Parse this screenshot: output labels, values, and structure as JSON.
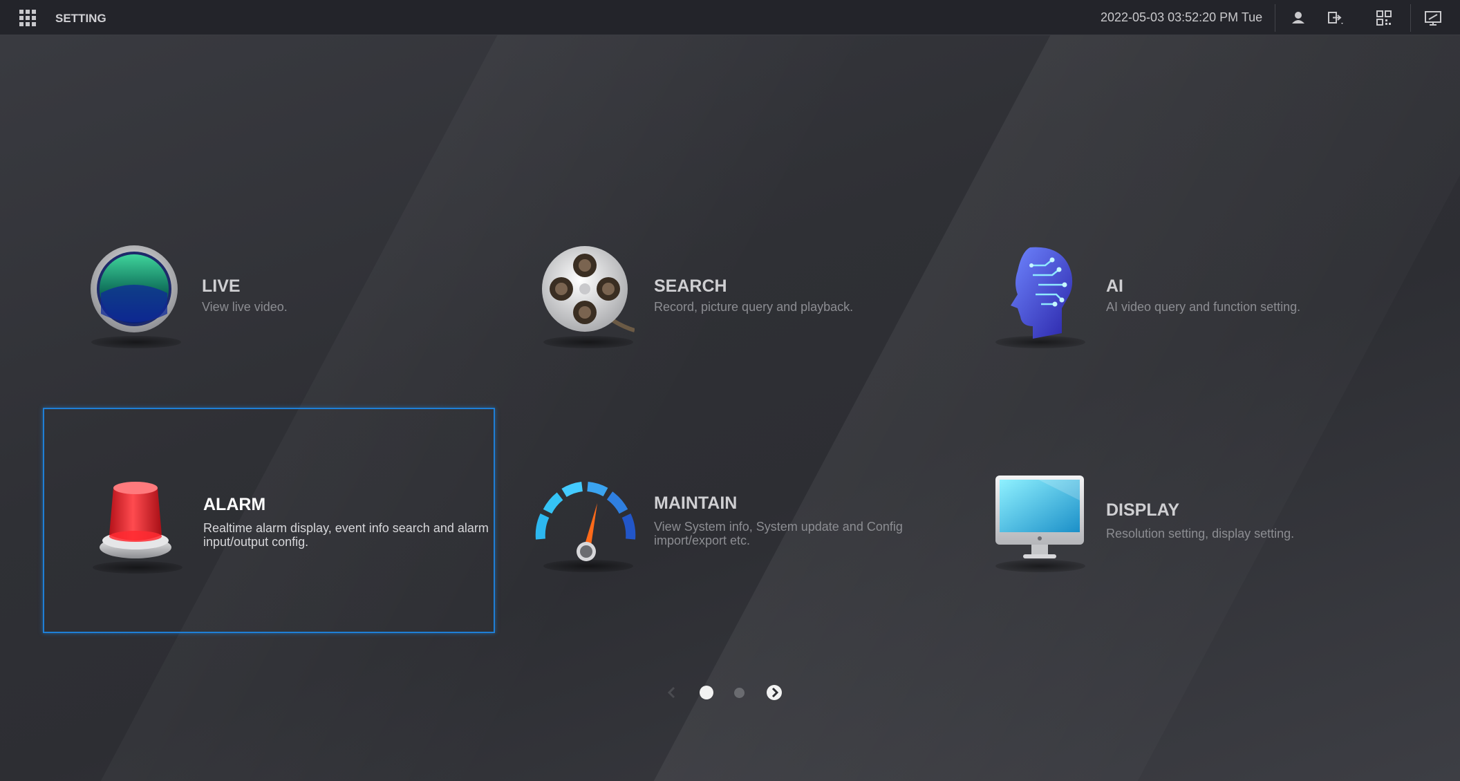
{
  "topbar": {
    "title": "SETTING",
    "datetime": "2022-05-03 03:52:20 PM Tue",
    "icons": [
      "grid-icon",
      "user-icon",
      "logout-icon",
      "qr-code-icon",
      "display-icon"
    ]
  },
  "tiles": [
    {
      "title": "LIVE",
      "desc": "View live video.",
      "icon": "live-icon"
    },
    {
      "title": "SEARCH",
      "desc": "Record, picture query and playback.",
      "icon": "film-reel-icon"
    },
    {
      "title": "AI",
      "desc": "AI video query and function setting.",
      "icon": "ai-head-icon"
    },
    {
      "title": "ALARM",
      "desc": "Realtime alarm display, event info search and alarm input/output config.",
      "icon": "alarm-siren-icon",
      "selected": true
    },
    {
      "title": "MAINTAIN",
      "desc": "View System info, System update and Config import/export etc.",
      "icon": "gauge-icon"
    },
    {
      "title": "DISPLAY",
      "desc": "Resolution setting, display setting.",
      "icon": "monitor-icon"
    }
  ],
  "pager": {
    "pages": 2,
    "current": 1
  },
  "colors": {
    "selection": "#1f7fd6",
    "background": "#2c2d32",
    "topbar": "#23242a"
  }
}
